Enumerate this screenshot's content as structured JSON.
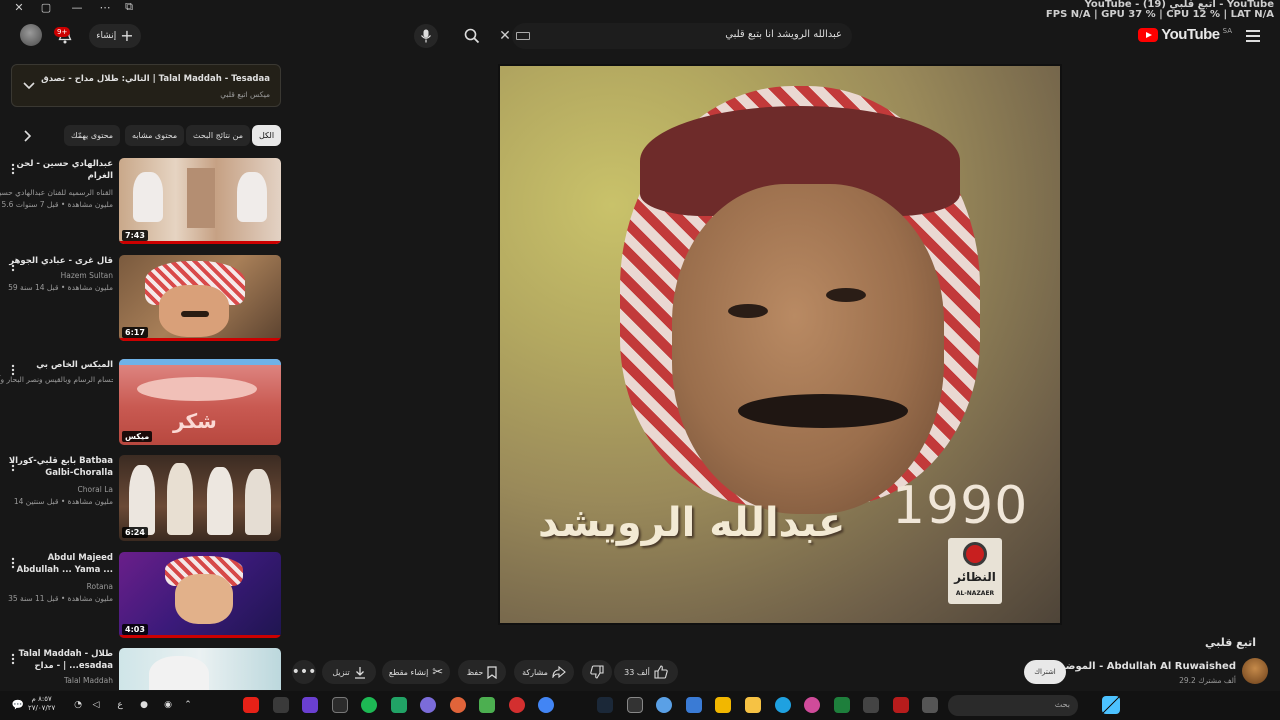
{
  "overlay": {
    "line1": "YouTube - اتبع قلبي (19) - YouTube",
    "line2": "FPS N/A  |  GPU 37 %  |  CPU 12 %  |  LAT N/A"
  },
  "header": {
    "logo_text": "YouTube",
    "logo_region": "SA",
    "search_value": "عبدالله الرويشد انا بتبع قلبي",
    "create_label": "إنشاء",
    "notification_count": "9+"
  },
  "playlist": {
    "title": "التالي: طلال مداح - تصدق | Talal Maddah - Tesadaa",
    "subtitle": "ميكس اتبع قلبي"
  },
  "chips": [
    "الكل",
    "من نتائج البحث",
    "محتوى مشابه",
    "محتوى يهمّك"
  ],
  "videos": [
    {
      "title": "عبدالهادي حسين - لحن الغرام",
      "channel": "القناه الرسميه للفنان عبدالهادي حسين",
      "meta": "5.6 مليون مشاهدة • قبل 7 سنوات",
      "duration": "7:43",
      "progress": 1.0
    },
    {
      "title": "قال غرى - عبادي الجوهر",
      "channel": "Hazem Sultan",
      "meta": "59 مليون مشاهدة • قبل 14 سنة",
      "duration": "6:17",
      "progress": 1.0
    },
    {
      "title": "الميكس الخاص بي",
      "channel": "حسام الرسام وبالقيس ونصر البحار وآل...",
      "meta": "",
      "duration": "ميكس",
      "progress": 0
    },
    {
      "title": "بابع قلبي-كورالا Batbaa Galbi-Choralla",
      "channel": "Choral La",
      "meta": "14 مليون مشاهدة • قبل سنتين",
      "duration": "6:24",
      "progress": 0
    },
    {
      "title": "Abdul Majeed Abdullah ... Yama ...",
      "channel": "Rotana",
      "meta": "35 مليون مشاهدة • قبل 11 سنة",
      "duration": "4:03",
      "progress": 1.0
    },
    {
      "title": "Talal Maddah - طلال مداح - | ...esadaa",
      "channel": "Talal Maddah",
      "meta": "",
      "duration": "",
      "progress": 0
    }
  ],
  "player": {
    "year_text": "1990",
    "artist_text": "عبدالله الرويشد",
    "label_ar": "النظائر",
    "label_en": "AL-NAZAER"
  },
  "video": {
    "title": "اتبع قلبي",
    "channel": "الموضوع - Abdullah Al Ruwaished",
    "subscribers": "29.2 ألف مشترك",
    "join_label": "اشتراك",
    "likes": "33 ألف",
    "share_label": "مشاركة",
    "save_label": "حفظ",
    "clip_label": "إنشاء مقطع",
    "download_label": "تنزيل"
  },
  "taskbar": {
    "search_placeholder": "بحث",
    "time": "٨:٥٧ م",
    "date": "٢٧/٠٧/٢٧",
    "lang": "ع"
  },
  "colors": {
    "accent": "#ff0000",
    "background": "#171717",
    "chip_bg": "#262626"
  }
}
